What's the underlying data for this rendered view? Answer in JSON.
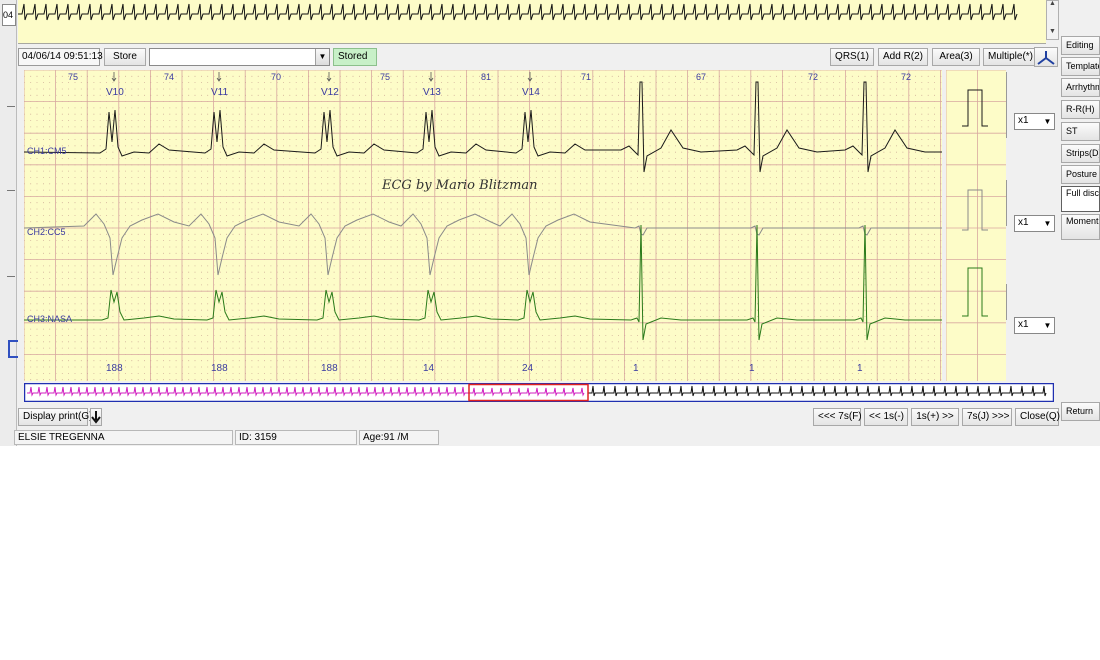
{
  "window": {
    "left_tab": "04"
  },
  "toolbar": {
    "datetime": "04/06/14 09:51:13",
    "store_label": "Store",
    "combo_value": "",
    "stored_label": "Stored",
    "qrs_label": "QRS(1)",
    "add_r_label": "Add R(2)",
    "area_label": "Area(3)",
    "multiple_label": "Multiple(*)"
  },
  "hr_values": [
    "75",
    "74",
    "70",
    "75",
    "81",
    "71",
    "67",
    "72",
    "72"
  ],
  "beat_labels": [
    "V10",
    "V11",
    "V12",
    "V13",
    "V14"
  ],
  "channels": [
    {
      "label": "CH1:CM5",
      "color": "#1a1a1a",
      "gain": "x1"
    },
    {
      "label": "CH2:CC5",
      "color": "#8a8a8a",
      "gain": "x1"
    },
    {
      "label": "CH3:NASA",
      "color": "#2a7a1a",
      "gain": "x1"
    }
  ],
  "rr_values": [
    "188",
    "188",
    "188",
    "14",
    "24",
    "1",
    "1",
    "1"
  ],
  "watermark": "ECG by Mario Blitzman",
  "bottom": {
    "display_print": "Display print(G)",
    "back7": "<<< 7s(F)",
    "back1": "<< 1s(-)",
    "fwd1": "1s(+) >>",
    "fwd7": "7s(J) >>>",
    "close": "Close(Q)"
  },
  "status": {
    "name": "ELSIE TREGENNA",
    "id": "ID: 3159",
    "age": "Age:91 /M"
  },
  "sidebar": {
    "items": [
      {
        "label": "Editing"
      },
      {
        "label": "Template"
      },
      {
        "label": "Arrhythmia"
      },
      {
        "label": "R-R(H)"
      },
      {
        "label": "ST"
      },
      {
        "label": "Strips(D)"
      },
      {
        "label": "Posture"
      },
      {
        "label": "Full disclosure"
      },
      {
        "label": "Moment HR"
      }
    ],
    "return_label": "Return"
  },
  "colors": {
    "grid_bg": "#fdfcc8",
    "grid_major": "#d8a8a0",
    "grid_minor_dot": "#c8a090",
    "label_blue": "#3a3aa0",
    "overview_pink": "#d020c0",
    "overview_frame": "#2030b0",
    "window_red": "#e02020"
  }
}
